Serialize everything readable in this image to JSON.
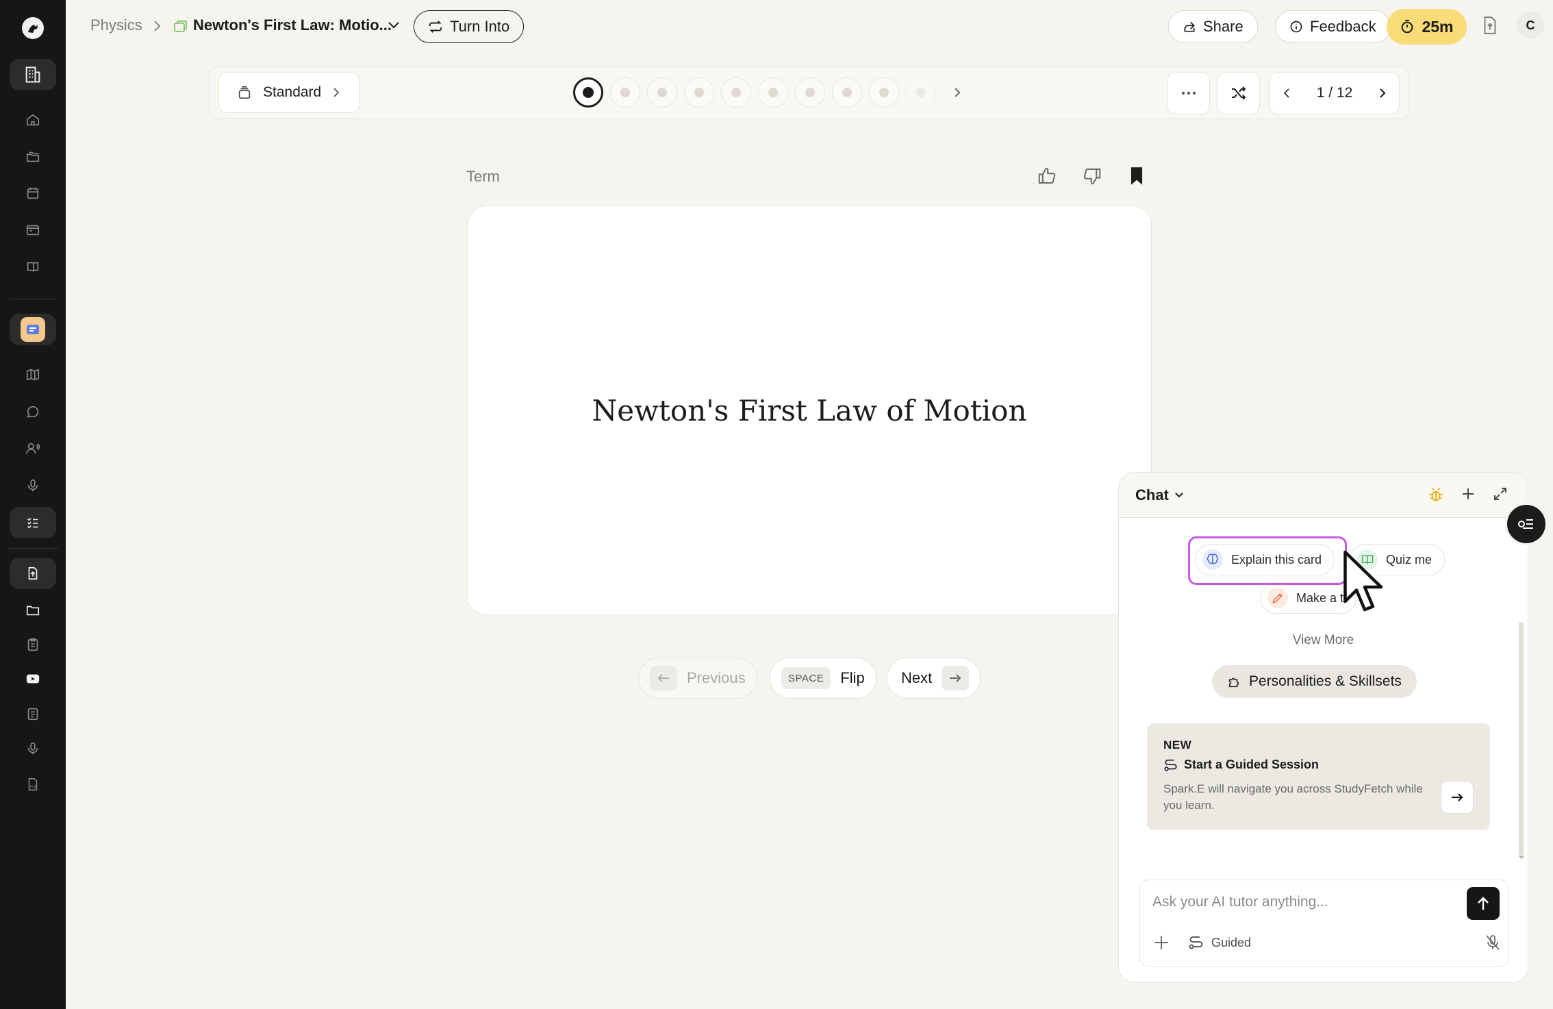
{
  "header": {
    "breadcrumb_parent": "Physics",
    "set_title": "Newton's First Law: Motio...",
    "turn_into_label": "Turn Into",
    "share_label": "Share",
    "feedback_label": "Feedback",
    "timer": "25m",
    "user_initial": "C"
  },
  "toolbar": {
    "mode_label": "Standard",
    "pager": "1 / 12",
    "progress_dot_count": 10,
    "current_index": 0
  },
  "card": {
    "side_label": "Term",
    "text": "Newton's First Law of Motion"
  },
  "nav": {
    "previous_label": "Previous",
    "flip_key": "SPACE",
    "flip_label": "Flip",
    "next_label": "Next"
  },
  "chat": {
    "title": "Chat",
    "chips": {
      "explain": "Explain this card",
      "quiz": "Quiz me",
      "make": "Make a t"
    },
    "view_more": "View More",
    "personalities": "Personalities & Skillsets",
    "guided_card": {
      "badge": "NEW",
      "title": "Start a Guided Session",
      "description": "Spark.E will navigate you across StudyFetch while you learn."
    },
    "input_placeholder": "Ask your AI tutor anything...",
    "guided_toggle": "Guided"
  },
  "colors": {
    "accent_highlight": "#c65be8",
    "timer_bg": "#f7dc78",
    "sidebar_bg": "#161616"
  }
}
